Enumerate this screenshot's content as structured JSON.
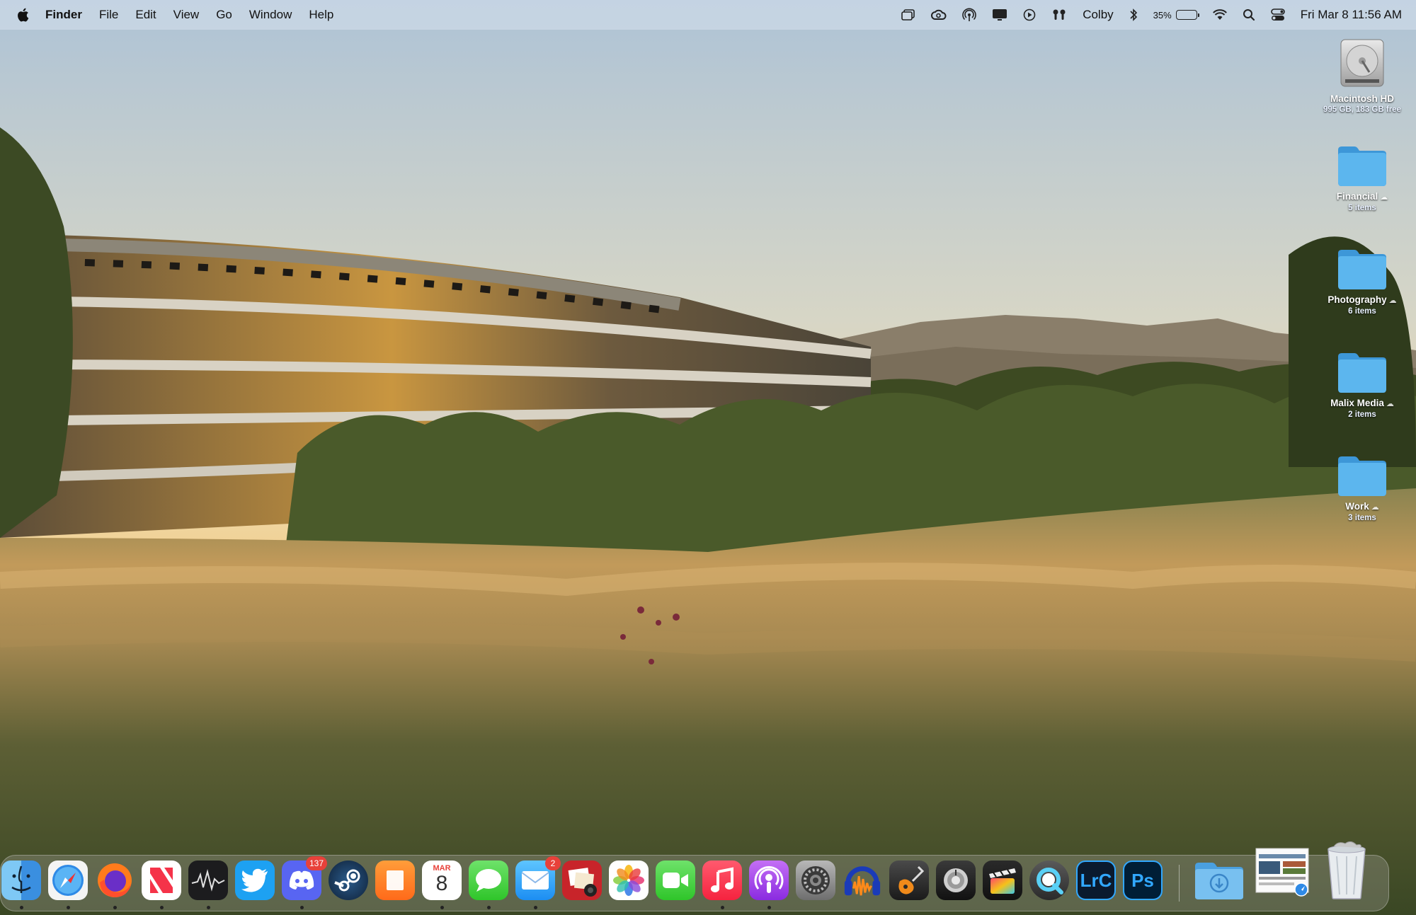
{
  "menubar": {
    "app_name": "Finder",
    "menus": [
      "File",
      "Edit",
      "View",
      "Go",
      "Window",
      "Help"
    ],
    "user": "Colby",
    "battery_percent": "35%",
    "battery_level": 0.35,
    "clock": "Fri Mar 8  11:56 AM",
    "status_icons": [
      "stage-manager-icon",
      "creative-cloud-icon",
      "airdrop-icon",
      "display-icon",
      "now-playing-icon",
      "airpods-icon",
      "bluetooth-icon",
      "wifi-icon",
      "spotlight-icon",
      "control-center-icon"
    ]
  },
  "desktop": {
    "drive": {
      "name": "Macintosh HD",
      "info": "995 GB, 183 GB free"
    },
    "folders": [
      {
        "name": "Financial",
        "count": "5 items"
      },
      {
        "name": "Photography",
        "count": "6 items"
      },
      {
        "name": "Malix Media",
        "count": "2 items"
      },
      {
        "name": "Work",
        "count": "3 items"
      }
    ]
  },
  "dock": {
    "apps": [
      {
        "name": "finder-icon",
        "running": true
      },
      {
        "name": "safari-icon",
        "running": true
      },
      {
        "name": "firefox-icon",
        "running": true
      },
      {
        "name": "news-icon",
        "running": true
      },
      {
        "name": "stocks-icon",
        "running": true
      },
      {
        "name": "twitter-icon",
        "running": false
      },
      {
        "name": "discord-icon",
        "running": true,
        "badge": "137"
      },
      {
        "name": "steam-icon",
        "running": false
      },
      {
        "name": "books-icon",
        "running": false
      },
      {
        "name": "calendar-icon",
        "running": true,
        "month": "MAR",
        "day": "8"
      },
      {
        "name": "messages-icon",
        "running": true
      },
      {
        "name": "mail-icon",
        "running": true,
        "badge": "2"
      },
      {
        "name": "photo-booth-icon",
        "running": false
      },
      {
        "name": "photos-icon",
        "running": false
      },
      {
        "name": "facetime-icon",
        "running": false
      },
      {
        "name": "music-icon",
        "running": true
      },
      {
        "name": "podcasts-icon",
        "running": true
      },
      {
        "name": "system-settings-icon",
        "running": false
      },
      {
        "name": "audacity-icon",
        "running": false
      },
      {
        "name": "garageband-icon",
        "running": false
      },
      {
        "name": "logic-icon",
        "running": false
      },
      {
        "name": "final-cut-icon",
        "running": false
      },
      {
        "name": "quicktime-icon",
        "running": false
      },
      {
        "name": "lightroom-classic-icon",
        "running": false,
        "label": "LrC"
      },
      {
        "name": "photoshop-icon",
        "running": false,
        "label": "Ps"
      }
    ],
    "stacks": [
      "downloads-stack-icon",
      "screenshot-stack-icon"
    ],
    "trash": "trash-icon"
  },
  "colors": {
    "menubar_bg": "#cddae8",
    "folder_blue": "#4aa8e8",
    "badge_red": "#e8413a"
  }
}
